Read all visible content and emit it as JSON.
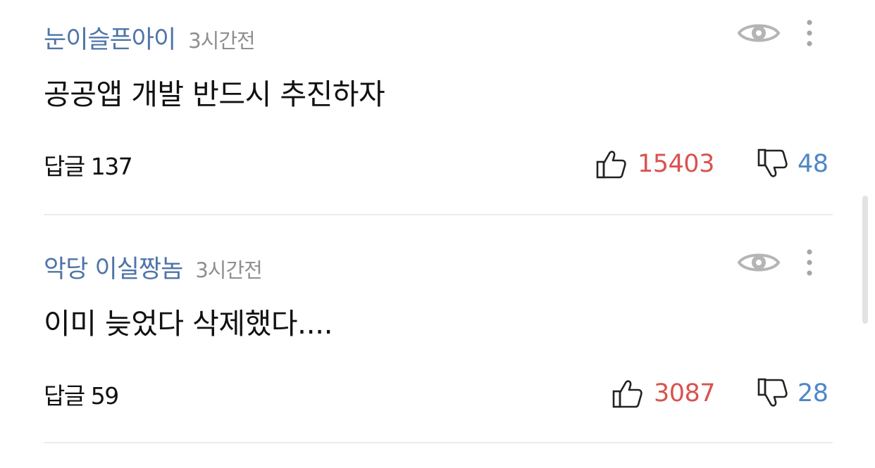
{
  "comments": [
    {
      "author": "눈이슬픈아이",
      "time": "3시간전",
      "text": "공공앱 개발 반드시 추진하자",
      "replies_label": "답글 137",
      "likes": "15403",
      "dislikes": "48"
    },
    {
      "author": "악당 이실짱놈",
      "time": "3시간전",
      "text": "이미 늦었다 삭제했다....",
      "replies_label": "답글 59",
      "likes": "3087",
      "dislikes": "28"
    }
  ],
  "icons": {
    "eye": "eye-icon",
    "more": "more-vertical-icon",
    "like": "thumbs-up-icon",
    "dislike": "thumbs-down-icon"
  },
  "colors": {
    "author": "#4f74a8",
    "time": "#8f8f8f",
    "like": "#d9534f",
    "dislike": "#4f86c6",
    "divider": "#ececec"
  }
}
